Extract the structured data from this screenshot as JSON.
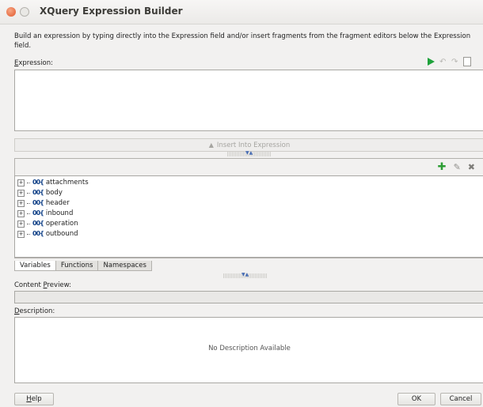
{
  "window": {
    "title": "XQuery Expression Builder"
  },
  "intro": "Build an expression by typing directly into the Expression field and/or insert fragments from the fragment editors below the Expression field.",
  "expression": {
    "mnemonic": "E",
    "label_rest": "xpression:",
    "value": ""
  },
  "insert_button": {
    "label": "Insert Into Expression"
  },
  "tree": {
    "items": [
      {
        "label": "attachments"
      },
      {
        "label": "body"
      },
      {
        "label": "header"
      },
      {
        "label": "inbound"
      },
      {
        "label": "operation"
      },
      {
        "label": "outbound"
      }
    ]
  },
  "tabs": [
    {
      "label": "Variables",
      "active": true
    },
    {
      "label": "Functions",
      "active": false
    },
    {
      "label": "Namespaces",
      "active": false
    }
  ],
  "content_preview": {
    "label_pre": "Content ",
    "mnemonic": "P",
    "label_rest": "review:",
    "value": ""
  },
  "description": {
    "mnemonic": "D",
    "label_rest": "escription:",
    "text": "No Description Available"
  },
  "buttons": {
    "help_mnemonic": "H",
    "help_rest": "elp",
    "ok": "OK",
    "cancel": "Cancel"
  },
  "icons": {
    "node_glyph": "00{",
    "expander_glyph": "+"
  },
  "colors": {
    "run_green": "#1fa23b",
    "add_green": "#2c9d34",
    "node_blue": "#0e3f86"
  }
}
